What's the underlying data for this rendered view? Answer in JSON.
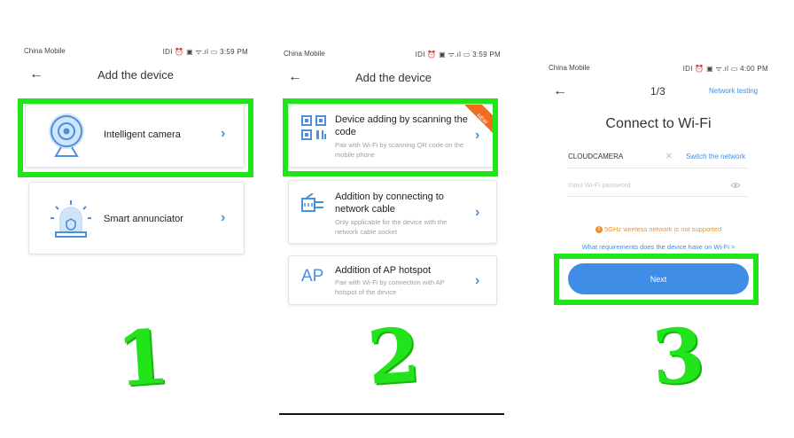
{
  "panels": [
    {
      "status": {
        "carrier": "China Mobile",
        "sys": "IDI ⏰ ▣ ᯤ.ıl ▭ 3:59 PM"
      },
      "header": {
        "title": "Add the device"
      },
      "cards": [
        {
          "label": "Intelligent camera"
        },
        {
          "label": "Smart annunciator"
        }
      ],
      "step_number": "1"
    },
    {
      "status": {
        "carrier": "China Mobile",
        "sys": "IDI ⏰ ▣ ᯤ.ıl ▭ 3:59 PM"
      },
      "header": {
        "title": "Add the device"
      },
      "cards": [
        {
          "label": "Device adding by scanning the code",
          "desc": "Pair with Wi-Fi by scanning QR code on the mobile phone",
          "badge": "NEW"
        },
        {
          "label": "Addition by connecting to network cable",
          "desc": "Only applicable for the device with the network cable socket"
        },
        {
          "icon_text": "AP",
          "label": "Addition of AP hotspot",
          "desc": "Pair with Wi-Fi by connection with AP hotspot of the device"
        }
      ],
      "step_number": "2"
    },
    {
      "status": {
        "carrier": "China Mobile",
        "sys": "IDI ⏰ ▣ ᯤ.ıl ▭ 4:00 PM"
      },
      "header": {
        "step": "1/3",
        "network_testing": "Network testing"
      },
      "heading": "Connect to Wi-Fi",
      "ssid": "CLOUDCAMERA",
      "switch_network": "Switch the network",
      "password_placeholder": "Input Wi-Fi password",
      "warning": "5GHz wireless network is not supported",
      "requirements_link": "What requirements does the device have on Wi-Fi >",
      "next_label": "Next",
      "step_number": "3"
    }
  ],
  "colors": {
    "accent": "#3f8de6",
    "highlight": "#22e41a",
    "warning": "#e8922f",
    "badge": "#f26a1b"
  }
}
